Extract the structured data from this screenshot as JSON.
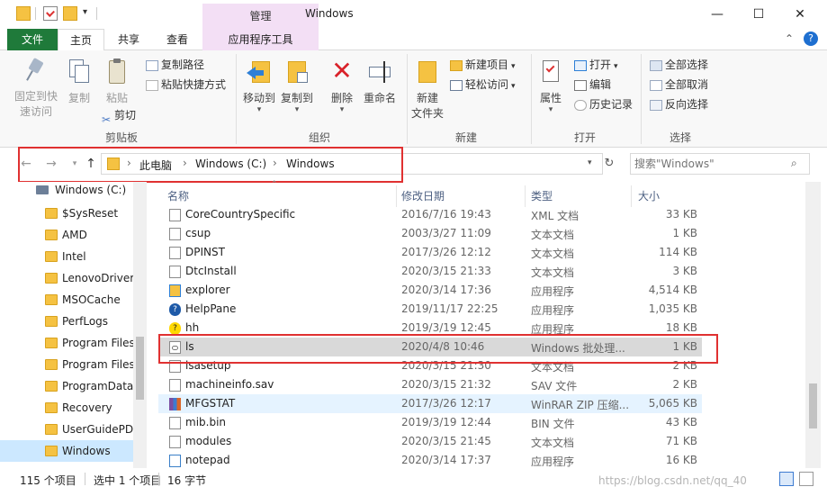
{
  "title_bar": {
    "manage_tab": "管理",
    "window_title": "Windows",
    "minimize": "—",
    "maximize": "☐",
    "close": "✕",
    "collapse_ribbon": "⌃",
    "help": "?"
  },
  "tabs": [
    {
      "label": "文件"
    },
    {
      "label": "主页"
    },
    {
      "label": "共享"
    },
    {
      "label": "查看"
    },
    {
      "label": "应用程序工具"
    }
  ],
  "ribbon": {
    "clipboard": {
      "pin_label_1": "固定到快",
      "pin_label_2": "速访问",
      "copy": "复制",
      "paste": "粘贴",
      "copy_path": "复制路径",
      "paste_shortcut": "粘贴快捷方式",
      "cut": "剪切",
      "group": "剪贴板"
    },
    "organize": {
      "move_to": "移动到",
      "copy_to": "复制到",
      "delete": "删除",
      "rename": "重命名",
      "group": "组织"
    },
    "new": {
      "new_folder_1": "新建",
      "new_folder_2": "文件夹",
      "new_item": "新建项目",
      "easy_access": "轻松访问",
      "group": "新建"
    },
    "open": {
      "properties": "属性",
      "open": "打开",
      "edit": "编辑",
      "history": "历史记录",
      "group": "打开"
    },
    "select": {
      "select_all": "全部选择",
      "select_none": "全部取消",
      "invert": "反向选择",
      "group": "选择"
    }
  },
  "address": {
    "crumbs": [
      "此电脑",
      "Windows (C:)",
      "Windows"
    ],
    "search_placeholder": "搜索\"Windows\""
  },
  "nav_pane": {
    "drive": "Windows (C:)",
    "items": [
      {
        "label": "$SysReset"
      },
      {
        "label": "AMD"
      },
      {
        "label": "Intel"
      },
      {
        "label": "LenovoDriver"
      },
      {
        "label": "MSOCache"
      },
      {
        "label": "PerfLogs"
      },
      {
        "label": "Program Files"
      },
      {
        "label": "Program Files"
      },
      {
        "label": "ProgramData"
      },
      {
        "label": "Recovery"
      },
      {
        "label": "UserGuidePD"
      },
      {
        "label": "Windows"
      }
    ]
  },
  "file_list": {
    "columns": {
      "name": "名称",
      "date": "修改日期",
      "type": "类型",
      "size": "大小"
    },
    "rows": [
      {
        "name": "CoreCountrySpecific",
        "date": "2016/7/16 19:43",
        "type": "XML 文档",
        "size": "33 KB",
        "icon": "doc-icon"
      },
      {
        "name": "csup",
        "date": "2003/3/27 11:09",
        "type": "文本文档",
        "size": "1 KB",
        "icon": "doc-icon"
      },
      {
        "name": "DPINST",
        "date": "2017/3/26 12:12",
        "type": "文本文档",
        "size": "114 KB",
        "icon": "doc-icon"
      },
      {
        "name": "DtcInstall",
        "date": "2020/3/15 21:33",
        "type": "文本文档",
        "size": "3 KB",
        "icon": "doc-icon"
      },
      {
        "name": "explorer",
        "date": "2020/3/14 17:36",
        "type": "应用程序",
        "size": "4,514 KB",
        "icon": "explorer-icon"
      },
      {
        "name": "HelpPane",
        "date": "2019/11/17 22:25",
        "type": "应用程序",
        "size": "1,035 KB",
        "icon": "help-icon"
      },
      {
        "name": "hh",
        "date": "2019/3/19 12:45",
        "type": "应用程序",
        "size": "18 KB",
        "icon": "hh-icon"
      },
      {
        "name": "ls",
        "date": "2020/4/8 10:46",
        "type": "Windows 批处理...",
        "size": "1 KB",
        "icon": "batch-icon"
      },
      {
        "name": "lsasetup",
        "date": "2020/3/15 21:30",
        "type": "文本文档",
        "size": "2 KB",
        "icon": "doc-icon"
      },
      {
        "name": "machineinfo.sav",
        "date": "2020/3/15 21:32",
        "type": "SAV 文件",
        "size": "2 KB",
        "icon": "doc-icon"
      },
      {
        "name": "MFGSTAT",
        "date": "2017/3/26 12:17",
        "type": "WinRAR ZIP 压缩...",
        "size": "5,065 KB",
        "icon": "zip-icon"
      },
      {
        "name": "mib.bin",
        "date": "2019/3/19 12:44",
        "type": "BIN 文件",
        "size": "43 KB",
        "icon": "doc-icon"
      },
      {
        "name": "modules",
        "date": "2020/3/15 21:45",
        "type": "文本文档",
        "size": "71 KB",
        "icon": "doc-icon"
      },
      {
        "name": "notepad",
        "date": "2020/3/14 17:37",
        "type": "应用程序",
        "size": "16 KB",
        "icon": "notepad-icon"
      }
    ]
  },
  "status": {
    "count": "115 个项目",
    "selected": "选中 1 个项目",
    "size": "16 字节"
  },
  "watermark": "https://blog.csdn.net/qq_40"
}
